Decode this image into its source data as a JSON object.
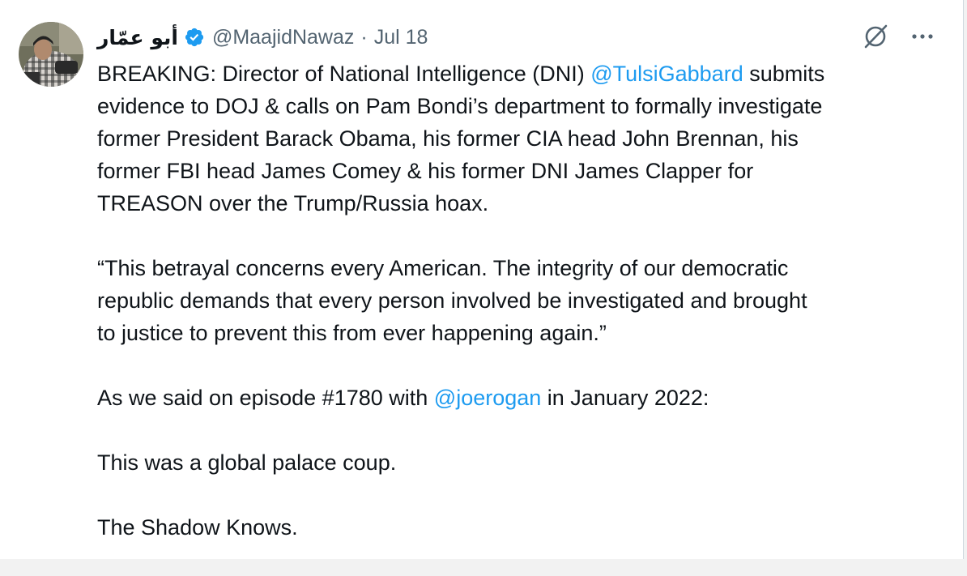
{
  "tweet": {
    "display_name": "أبو عمّار",
    "handle": "@MaajidNawaz",
    "separator": "·",
    "date": "Jul 18",
    "paragraph1": {
      "line1_start": "BREAKING: Director of National Intelligence (DNI) ",
      "mention": "@TulsiGabbard",
      "line1_end": " submits",
      "line2": "evidence to DOJ & calls on Pam Bondi’s department to formally investigate",
      "line3": "former President Barack Obama, his former CIA head John Brennan, his",
      "line4": "former FBI head James Comey & his former DNI James Clapper for",
      "line5": "TREASON over the Trump/Russia hoax."
    },
    "paragraph2": {
      "line1": "“This betrayal concerns every American. The integrity of our democratic",
      "line2": "republic demands that every person involved be investigated and brought",
      "line3": "to justice to prevent this from ever happening again.”"
    },
    "paragraph3": {
      "start": "As we said on episode #1780 with ",
      "mention": "@joerogan",
      "end": " in January 2022:"
    },
    "paragraph4": "This was a global palace coup.",
    "paragraph5": "The Shadow Knows."
  },
  "icons": {
    "verified": "verified-badge-icon",
    "grok": "grok-icon",
    "more": "more-horizontal-icon"
  },
  "colors": {
    "accent": "#1d9bf0",
    "text": "#0f1419",
    "secondary": "#536471"
  }
}
